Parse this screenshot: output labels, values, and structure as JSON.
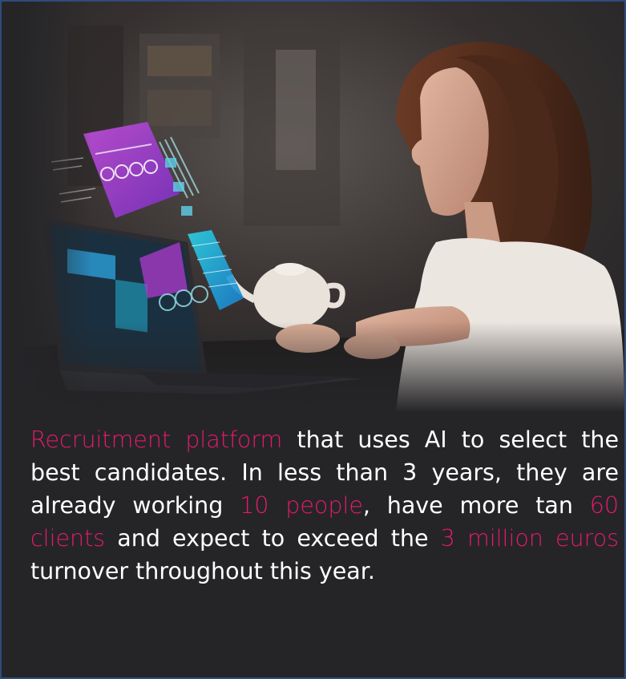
{
  "description": {
    "s1_highlight": "Recruitment platform",
    "s2": " that uses AI to select the best candidates. In less than 3 years, they are already working ",
    "s3_highlight": "10 people",
    "s4": ", have more tan ",
    "s5_highlight": "60 clients",
    "s6": " and expect to exceed the ",
    "s7_highlight": "3 million euros",
    "s8": " turnover throughout this year."
  },
  "colors": {
    "highlight": "#e8196a",
    "text": "#ffffff",
    "background": "#252528",
    "border": "#2f4b7c"
  }
}
